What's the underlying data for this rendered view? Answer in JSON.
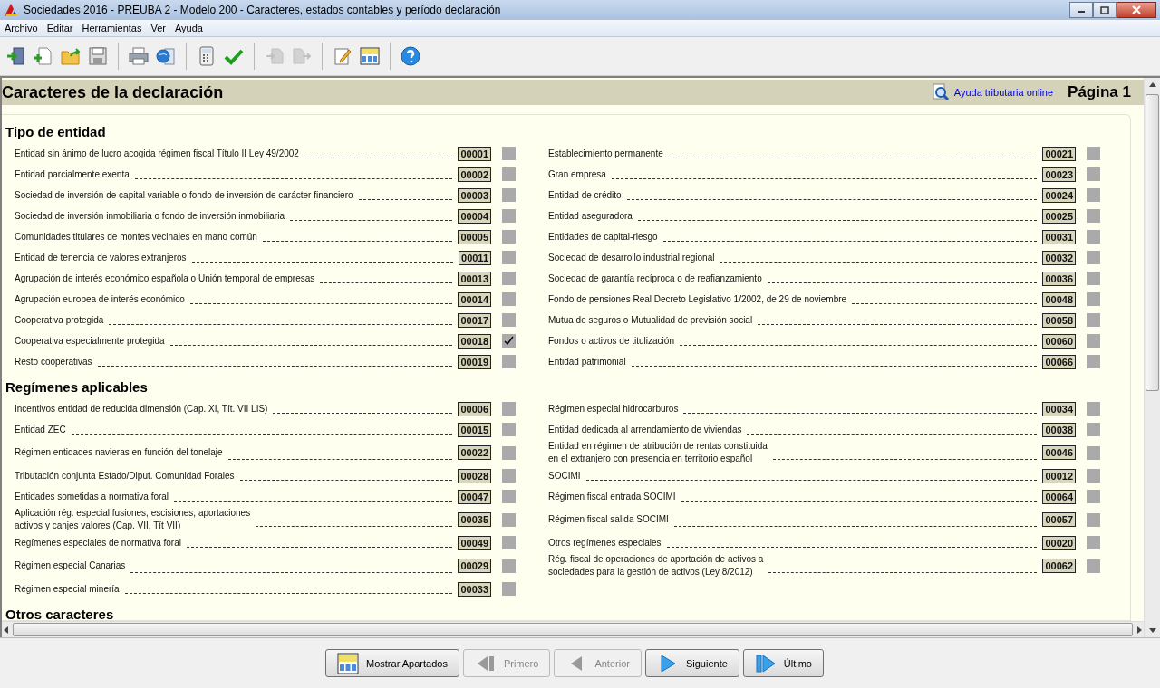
{
  "window": {
    "title": "Sociedades 2016 - PREUBA 2 - Modelo 200 - Caracteres, estados contables y período declaración"
  },
  "menu": [
    "Archivo",
    "Editar",
    "Herramientas",
    "Ver",
    "Ayuda"
  ],
  "toolbar": [
    {
      "disabled": false
    },
    {
      "disabled": false
    },
    {
      "disabled": false
    },
    {
      "disabled": false
    },
    {
      "disabled": false
    },
    {
      "disabled": false
    },
    {
      "disabled": false
    },
    {
      "disabled": false
    },
    {
      "disabled": true
    },
    {
      "disabled": true
    },
    {
      "disabled": false
    },
    {
      "disabled": false
    },
    {
      "disabled": false
    }
  ],
  "header": {
    "title": "Caracteres de la declaración",
    "help_link": "Ayuda tributaria online",
    "page": "Página 1"
  },
  "sections": [
    {
      "title": "Tipo de entidad",
      "left": [
        {
          "label": "Entidad sin ánimo de lucro acogida régimen fiscal Título II Ley 49/2002",
          "code": "00001",
          "checked": false
        },
        {
          "label": "Entidad parcialmente exenta",
          "code": "00002",
          "checked": false
        },
        {
          "label": "Sociedad de inversión de capital variable o fondo de inversión de carácter financiero",
          "code": "00003",
          "checked": false
        },
        {
          "label": "Sociedad de inversión inmobiliaria o fondo de inversión inmobiliaria",
          "code": "00004",
          "checked": false
        },
        {
          "label": "Comunidades titulares de montes vecinales en mano común",
          "code": "00005",
          "checked": false
        },
        {
          "label": "Entidad de tenencia de valores extranjeros",
          "code": "00011",
          "checked": false
        },
        {
          "label": "Agrupación de interés económico española o Unión temporal de empresas",
          "code": "00013",
          "checked": false
        },
        {
          "label": "Agrupación europea de interés económico",
          "code": "00014",
          "checked": false
        },
        {
          "label": "Cooperativa protegida",
          "code": "00017",
          "checked": false
        },
        {
          "label": "Cooperativa especialmente protegida",
          "code": "00018",
          "checked": true
        },
        {
          "label": "Resto cooperativas",
          "code": "00019",
          "checked": false
        }
      ],
      "right": [
        {
          "label": "Establecimiento permanente",
          "code": "00021",
          "checked": false
        },
        {
          "label": "Gran empresa",
          "code": "00023",
          "checked": false
        },
        {
          "label": "Entidad de crédito",
          "code": "00024",
          "checked": false
        },
        {
          "label": "Entidad aseguradora",
          "code": "00025",
          "checked": false
        },
        {
          "label": "Entidades de capital-riesgo",
          "code": "00031",
          "checked": false
        },
        {
          "label": "Sociedad de desarrollo industrial regional",
          "code": "00032",
          "checked": false
        },
        {
          "label": "Sociedad de garantía recíproca o de reafianzamiento",
          "code": "00036",
          "checked": false
        },
        {
          "label": "Fondo de pensiones Real Decreto Legislativo 1/2002, de 29 de noviembre",
          "code": "00048",
          "checked": false
        },
        {
          "label": "Mutua de seguros o Mutualidad de previsión social",
          "code": "00058",
          "checked": false
        },
        {
          "label": "Fondos o activos de titulización",
          "code": "00060",
          "checked": false
        },
        {
          "label": "Entidad patrimonial",
          "code": "00066",
          "checked": false
        }
      ]
    },
    {
      "title": "Regímenes aplicables",
      "left": [
        {
          "label": "Incentivos entidad de reducida dimensión (Cap. XI, Tít. VII LIS)",
          "code": "00006",
          "checked": false
        },
        {
          "label": "Entidad ZEC",
          "code": "00015",
          "checked": false
        },
        {
          "label": "Régimen entidades navieras en función del tonelaje",
          "code": "00022",
          "checked": false
        },
        {
          "label": "Tributación conjunta Estado/Diput. Comunidad Forales",
          "code": "00028",
          "checked": false
        },
        {
          "label": "Entidades sometidas a normativa foral",
          "code": "00047",
          "checked": false
        },
        {
          "label": "Aplicación rég. especial fusiones, escisiones, aportaciones\nactivos y canjes valores (Cap. VII, Tít VII)",
          "code": "00035",
          "checked": false
        },
        {
          "label": "Regímenes especiales de normativa foral",
          "code": "00049",
          "checked": false
        },
        {
          "label": "Régimen especial Canarias",
          "code": "00029",
          "checked": false
        },
        {
          "label": "Régimen especial minería",
          "code": "00033",
          "checked": false
        }
      ],
      "right": [
        {
          "label": "Régimen especial hidrocarburos",
          "code": "00034",
          "checked": false
        },
        {
          "label": "Entidad dedicada al arrendamiento de viviendas",
          "code": "00038",
          "checked": false
        },
        {
          "label": "Entidad en régimen de atribución de rentas constituida\nen el extranjero con presencia en territorio español",
          "code": "00046",
          "checked": false
        },
        {
          "label": "SOCIMI",
          "code": "00012",
          "checked": false
        },
        {
          "label": "Régimen fiscal entrada SOCIMI",
          "code": "00064",
          "checked": false
        },
        {
          "label": "Régimen fiscal salida SOCIMI",
          "code": "00057",
          "checked": false
        },
        {
          "label": "Otros regímenes especiales",
          "code": "00020",
          "checked": false
        },
        {
          "label": "Rég. fiscal de operaciones de aportación de activos a\nsociedades para la gestión de activos (Ley 8/2012)",
          "code": "00062",
          "checked": false
        }
      ]
    },
    {
      "title": "Otros caracteres"
    }
  ],
  "bottom_buttons": [
    {
      "label": "Mostrar Apartados",
      "disabled": false
    },
    {
      "label": "Primero",
      "disabled": true
    },
    {
      "label": "Anterior",
      "disabled": true
    },
    {
      "label": "Siguiente",
      "disabled": false
    },
    {
      "label": "Último",
      "disabled": false
    }
  ]
}
